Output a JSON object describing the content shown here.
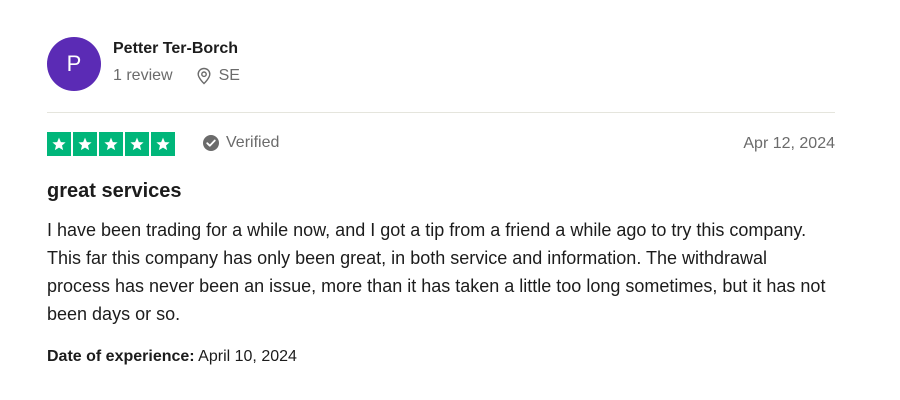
{
  "reviewer": {
    "avatar_initial": "P",
    "avatar_color": "#5b2bb5",
    "name": "Petter Ter-Borch",
    "review_count": "1 review",
    "location_icon": "location-pin-icon",
    "country": "SE"
  },
  "review": {
    "rating": 5,
    "rating_max": 5,
    "star_color": "#00b67a",
    "verified_icon": "check-circle-icon",
    "verified_label": "Verified",
    "date": "Apr 12, 2024",
    "title": "great services",
    "body": "I have been trading for a while now, and I got a tip from a friend a while ago to try this company. This far this company has only been great, in both service and information. The withdrawal process has never been an issue, more than it has taken a little too long sometimes, but it has not been days or so.",
    "experience_label": "Date of experience:",
    "experience_date": "April 10, 2024"
  }
}
